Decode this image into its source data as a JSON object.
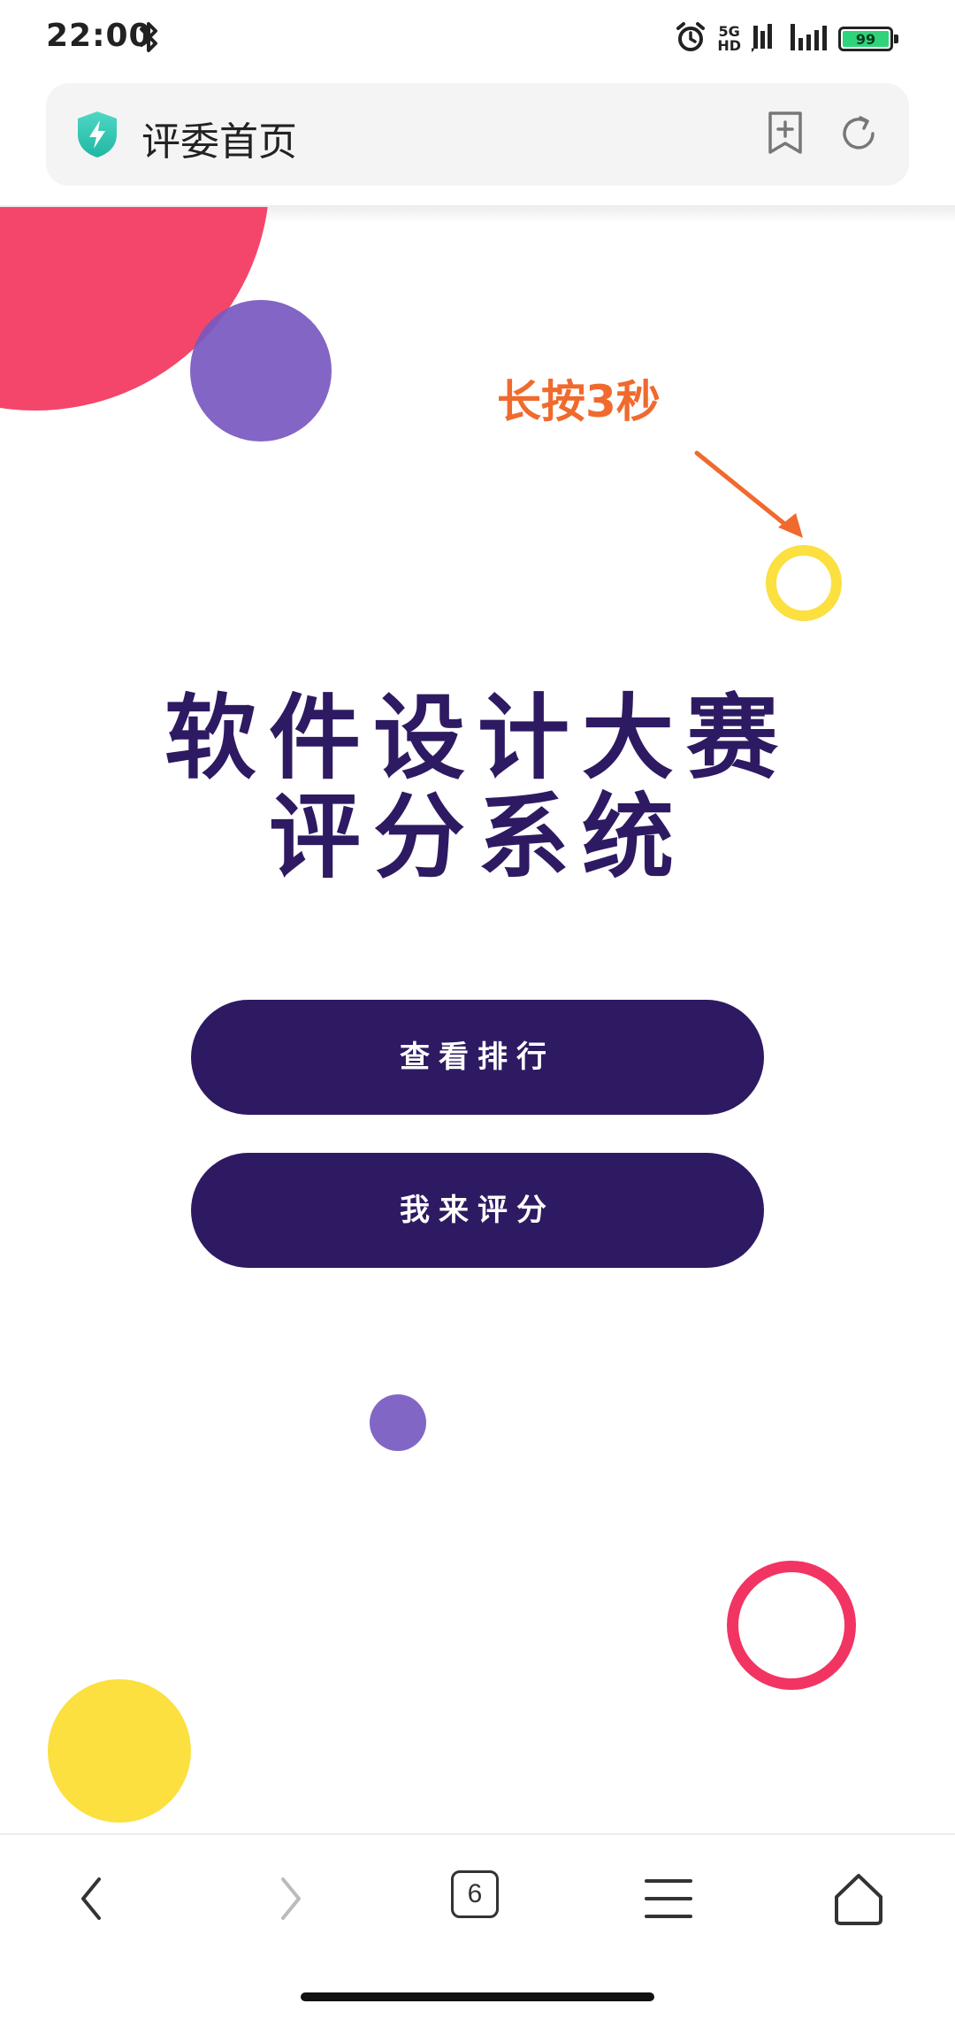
{
  "status_bar": {
    "time": "22:00",
    "network_label_top": "5G",
    "network_label_bottom": "HD",
    "battery_level": "99",
    "icons": [
      "bluetooth-icon",
      "alarm-icon",
      "5g-hd-icon",
      "volte-signal-icon",
      "cellular-signal-icon",
      "battery-icon"
    ]
  },
  "address_bar": {
    "title": "评委首页",
    "icons": [
      "shield-icon",
      "bookmark-add-icon",
      "refresh-icon"
    ]
  },
  "content": {
    "hint": "长按3秒",
    "title_line1": "软件设计大赛",
    "title_line2": "评分系统",
    "buttons": {
      "ranking": "查看排行",
      "score": "我来评分"
    },
    "colors": {
      "brand_dark": "#2e1a62",
      "pink": "#f4466a",
      "purple": "#7858c0",
      "yellow": "#fbe03f",
      "hint_orange": "#f06a2e"
    }
  },
  "bottom_nav": {
    "tab_count": "6",
    "icons": [
      "back-icon",
      "forward-icon",
      "tabs-icon",
      "menu-icon",
      "home-icon"
    ]
  }
}
